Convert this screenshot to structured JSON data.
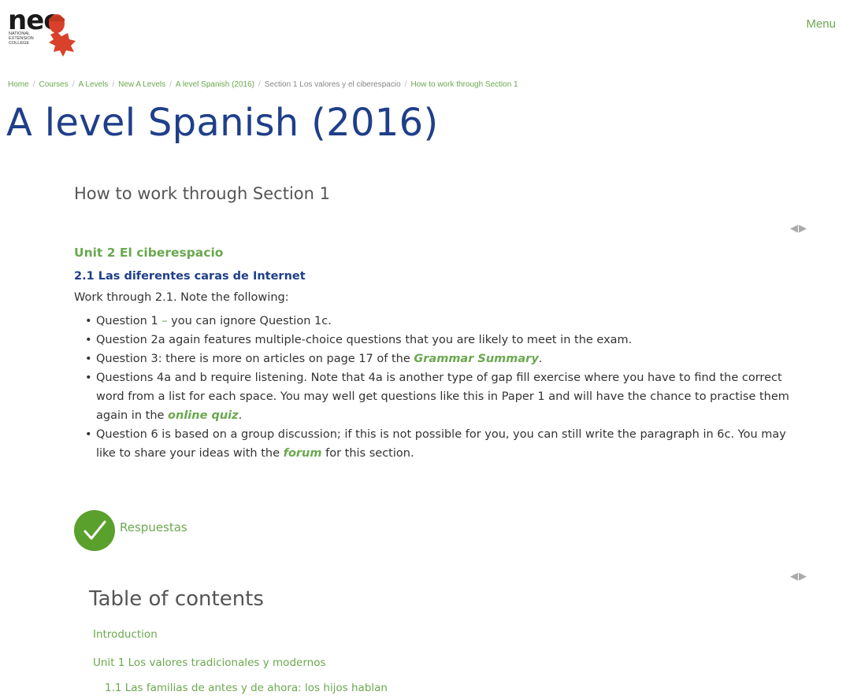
{
  "header": {
    "logo_text": "nec",
    "logo_subtitle": "NATIONAL EXTENSION COLLEGE",
    "menu_label": "Menu"
  },
  "breadcrumb": [
    {
      "label": "Home"
    },
    {
      "label": "Courses"
    },
    {
      "label": "A Levels"
    },
    {
      "label": "New A Levels"
    },
    {
      "label": "A level Spanish (2016)"
    },
    {
      "label": "Section 1 Los valores y el ciberespacio"
    },
    {
      "label": "How to work through Section 1"
    }
  ],
  "page_title": "A level Spanish (2016)",
  "section_title": "How to work through Section 1",
  "nav": {
    "prev_icon": "left-triangle-icon",
    "next_icon": "right-triangle-icon"
  },
  "content": {
    "unit_heading": "Unit 2 El ciberespacio",
    "sub_heading": "2.1 Las diferentes caras de Internet",
    "intro": "Work through 2.1. Note the following:",
    "bullets": {
      "b1_a": "Question 1 ",
      "b1_dash": "–",
      "b1_b": " you can ignore Question 1c.",
      "b2": "Question 2a again features multiple-choice questions that you are likely to meet in the exam.",
      "b3_a": "Question 3: there is more on articles on page 17 of the ",
      "b3_link": "Grammar Summary",
      "b3_b": ".",
      "b4_a": "Questions 4a and b require listening. Note that 4a is another type of gap fill exercise where you have to find the correct word from a list for each space. You may well get questions like this in Paper 1 and will have the chance to practise them again in the ",
      "b4_link": "online quiz",
      "b4_b": ".",
      "b5_a": "Question 6 is based on a group discussion; if this is not possible for you, you can still write the paragraph in 6c. You may like to share your ideas with the ",
      "b5_link": "forum",
      "b5_b": " for this section."
    },
    "answers_label": "Respuestas",
    "answers_icon": "checkmark-icon"
  },
  "toc": {
    "heading": "Table of contents",
    "items": [
      "Introduction",
      "Unit 1 Los valores tradicionales y modernos",
      "1.1 Las familias de antes y de ahora: los hijos hablan"
    ]
  },
  "colors": {
    "accent_green": "#6aa84f",
    "title_blue": "#1f3f8a",
    "logo_red": "#d9412b"
  }
}
